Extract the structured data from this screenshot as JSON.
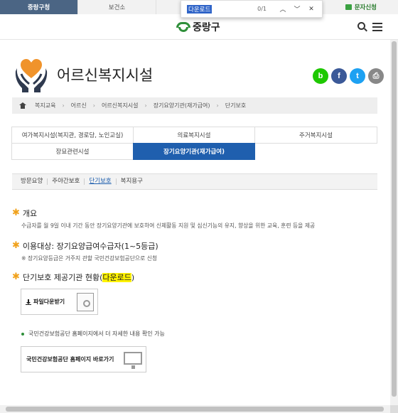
{
  "topbar": {
    "tabs": [
      "중랑구청",
      "보건소"
    ],
    "sms_label": "문자신청",
    "colors": {
      "active_tab": "#4b6584",
      "sms": "#2a7d2e"
    }
  },
  "find_bar": {
    "query": "다운로드",
    "count": "0/1",
    "up_icon": "chevron-up-icon",
    "down_icon": "chevron-down-icon",
    "close_icon": "close-icon"
  },
  "header": {
    "logo_text": "중랑구",
    "search_icon": "search-icon",
    "menu_icon": "hamburger-menu-icon"
  },
  "page": {
    "title": "어르신복지시설",
    "title_icon": "heart-hands-icon",
    "share_icons": [
      "blog-icon",
      "facebook-icon",
      "twitter-icon",
      "print-icon"
    ],
    "share_letters": [
      "b",
      "f",
      "t",
      "⎙"
    ],
    "share_colors": [
      "#1ec800",
      "#3b5998",
      "#1da1f2",
      "#888888"
    ]
  },
  "breadcrumb": {
    "home_icon": "home-icon",
    "items": [
      "복지교육",
      "어르신",
      "어르신복지시설",
      "장기요양기관(재가급여)",
      "단기보호"
    ]
  },
  "facility_menu": {
    "items": [
      {
        "label": "여가복지시설(복지관, 경로당, 노인교실)",
        "active": false
      },
      {
        "label": "의료복지시설",
        "active": false
      },
      {
        "label": "주거복지시설",
        "active": false
      },
      {
        "label": "장묘관련시설",
        "active": false
      },
      {
        "label": "장기요양기관(재가급여)",
        "active": true
      }
    ],
    "active_color": "#1f5fae"
  },
  "sub_tabs": {
    "items": [
      "방문요양",
      "주야간보호",
      "단기보호",
      "복지용구"
    ],
    "active_index": 2
  },
  "sections": {
    "overview": {
      "heading": "개요",
      "text": "수급자를 월 9일 이내 기간 동안 장기요양기관에 보호하여 신체활동 지원 및 심신기능의 유지, 향상을 위한 교육, 훈련 등을 제공"
    },
    "target": {
      "heading": "이용대상: 장기요양급여수급자(1~5등급)",
      "note": "※ 장기요양등급은 거주지 관할 국민건강보험공단으로 신청"
    },
    "status": {
      "heading_prefix": "단기보호 제공기관 현황(",
      "heading_highlight": "다운로드",
      "heading_suffix": ")",
      "download_button": "파일다운받기"
    },
    "nhis": {
      "info": "국민건강보험공단 홈페이지에서 더 자세한 내용 확인 가능",
      "button": "국민건강보험공단 홈페이지 바로가기"
    }
  },
  "accent_star_color": "#f0a11b"
}
